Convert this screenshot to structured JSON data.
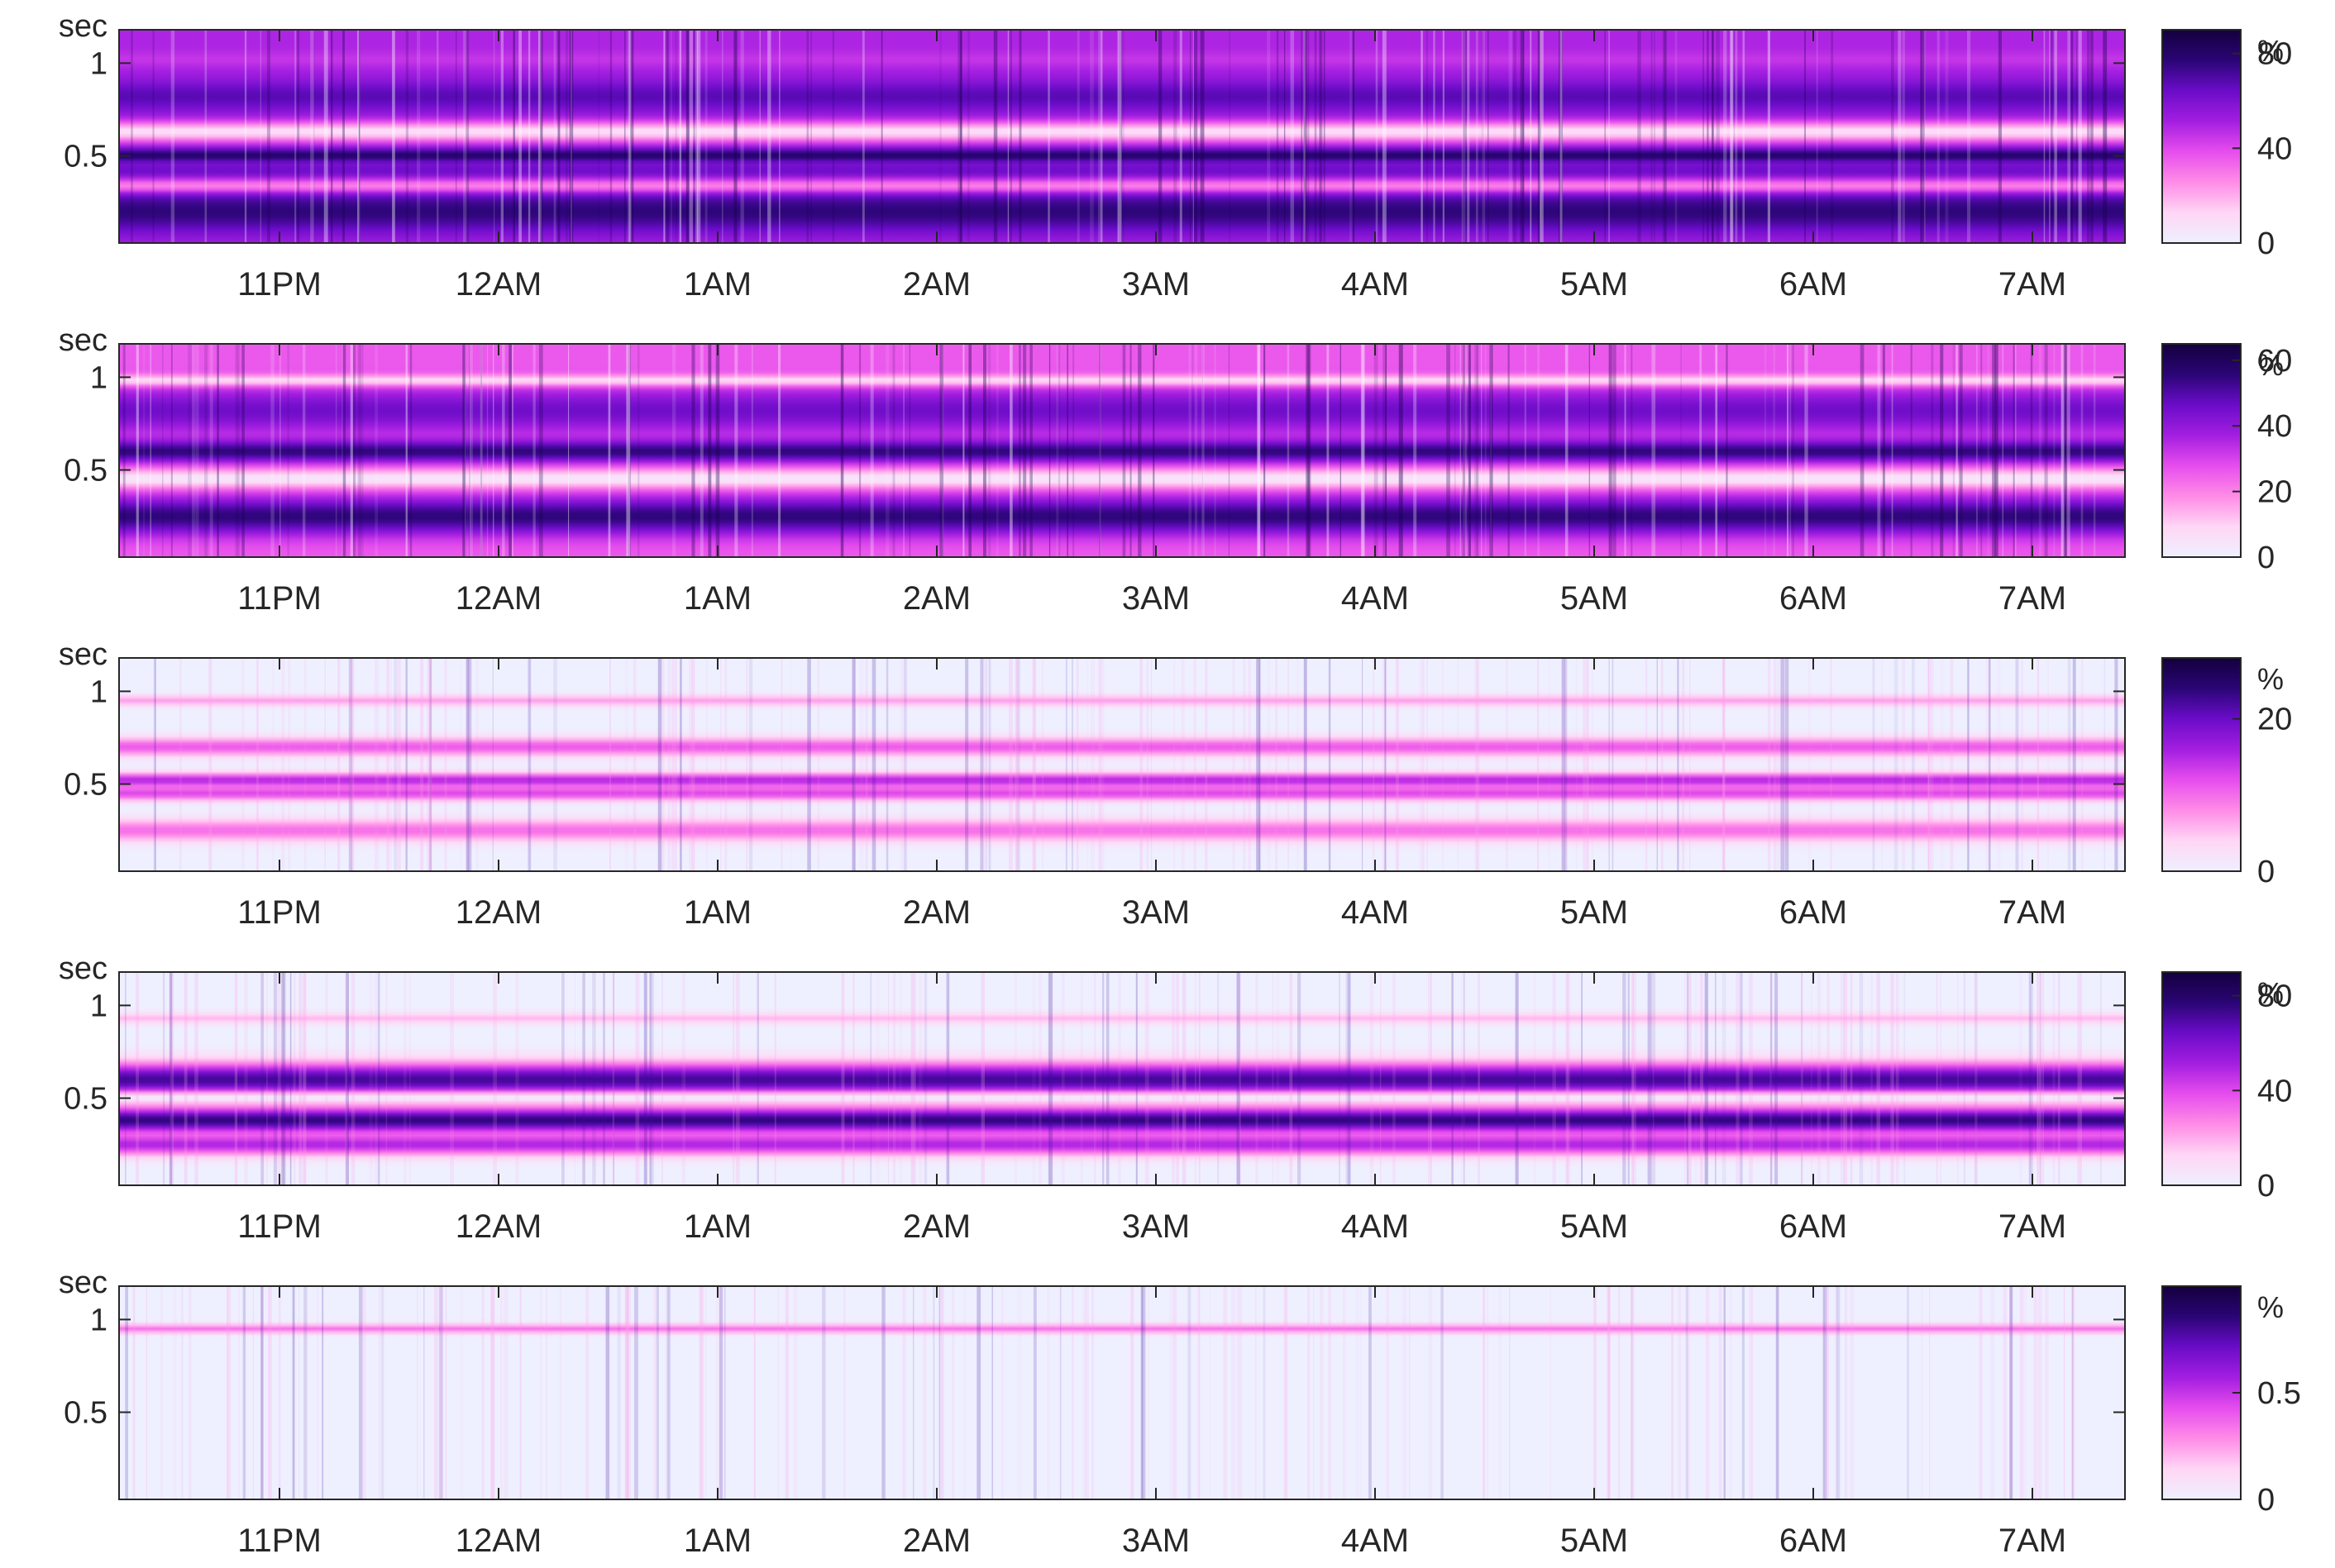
{
  "chart_data": [
    {
      "type": "heatmap",
      "y_unit_label": "sec",
      "y_ticks": [
        "1",
        "0.5"
      ],
      "y_tick_values": [
        1,
        0.5
      ],
      "x_ticks": [
        "11PM",
        "12AM",
        "1AM",
        "2AM",
        "3AM",
        "4AM",
        "5AM",
        "6AM",
        "7AM"
      ],
      "colorbar": {
        "unit": "%",
        "ticks": [
          "0",
          "40",
          "80"
        ],
        "tick_values": [
          0,
          40,
          80
        ],
        "range": [
          0,
          90
        ]
      },
      "bands": [
        {
          "sec": 1.02,
          "level": 0.5,
          "width": 0.04
        },
        {
          "sec": 0.82,
          "level": 0.75,
          "width": 0.09
        },
        {
          "sec": 0.63,
          "level": 0.1,
          "width": 0.05
        },
        {
          "sec": 0.5,
          "level": 0.9,
          "width": 0.04
        },
        {
          "sec": 0.42,
          "level": 0.7,
          "width": 0.05
        },
        {
          "sec": 0.33,
          "level": 0.1,
          "width": 0.04
        },
        {
          "sec": 0.2,
          "level": 0.85,
          "width": 0.12
        }
      ],
      "background_level": 0.55
    },
    {
      "type": "heatmap",
      "y_unit_label": "sec",
      "y_ticks": [
        "1",
        "0.5"
      ],
      "y_tick_values": [
        1,
        0.5
      ],
      "x_ticks": [
        "11PM",
        "12AM",
        "1AM",
        "2AM",
        "3AM",
        "4AM",
        "5AM",
        "6AM",
        "7AM"
      ],
      "colorbar": {
        "unit": "%",
        "ticks": [
          "0",
          "20",
          "40",
          "60"
        ],
        "tick_values": [
          0,
          20,
          40,
          60
        ],
        "range": [
          0,
          65
        ]
      },
      "bands": [
        {
          "sec": 0.98,
          "level": 0.0,
          "width": 0.03
        },
        {
          "sec": 0.82,
          "level": 0.7,
          "width": 0.12
        },
        {
          "sec": 0.6,
          "level": 0.85,
          "width": 0.06
        },
        {
          "sec": 0.45,
          "level": 0.05,
          "width": 0.05
        },
        {
          "sec": 0.25,
          "level": 0.85,
          "width": 0.1
        }
      ],
      "background_level": 0.4
    },
    {
      "type": "heatmap",
      "y_unit_label": "sec",
      "y_ticks": [
        "1",
        "0.5"
      ],
      "y_tick_values": [
        1,
        0.5
      ],
      "x_ticks": [
        "11PM",
        "12AM",
        "1AM",
        "2AM",
        "3AM",
        "4AM",
        "5AM",
        "6AM",
        "7AM"
      ],
      "colorbar": {
        "unit": "%",
        "ticks": [
          "0",
          "20"
        ],
        "tick_values": [
          0,
          20
        ],
        "range": [
          0,
          28
        ]
      },
      "bands": [
        {
          "sec": 0.95,
          "level": 0.25,
          "width": 0.03
        },
        {
          "sec": 0.7,
          "level": 0.4,
          "width": 0.05
        },
        {
          "sec": 0.52,
          "level": 0.55,
          "width": 0.04
        },
        {
          "sec": 0.45,
          "level": 0.45,
          "width": 0.04
        },
        {
          "sec": 0.25,
          "level": 0.35,
          "width": 0.06
        }
      ],
      "background_level": 0.0
    },
    {
      "type": "heatmap",
      "y_unit_label": "sec",
      "y_ticks": [
        "1",
        "0.5"
      ],
      "y_tick_values": [
        1,
        0.5
      ],
      "x_ticks": [
        "11PM",
        "12AM",
        "1AM",
        "2AM",
        "3AM",
        "4AM",
        "5AM",
        "6AM",
        "7AM"
      ],
      "colorbar": {
        "unit": "%",
        "ticks": [
          "0",
          "40",
          "80"
        ],
        "tick_values": [
          0,
          40,
          80
        ],
        "range": [
          0,
          90
        ]
      },
      "bands": [
        {
          "sec": 0.93,
          "level": 0.2,
          "width": 0.03
        },
        {
          "sec": 0.6,
          "level": 0.8,
          "width": 0.09
        },
        {
          "sec": 0.5,
          "level": 0.0,
          "width": 0.03
        },
        {
          "sec": 0.38,
          "level": 0.85,
          "width": 0.07
        },
        {
          "sec": 0.25,
          "level": 0.55,
          "width": 0.06
        }
      ],
      "background_level": 0.0
    },
    {
      "type": "heatmap",
      "y_unit_label": "sec",
      "y_ticks": [
        "1",
        "0.5"
      ],
      "y_tick_values": [
        1,
        0.5
      ],
      "x_ticks": [
        "11PM",
        "12AM",
        "1AM",
        "2AM",
        "3AM",
        "4AM",
        "5AM",
        "6AM",
        "7AM"
      ],
      "colorbar": {
        "unit": "%",
        "ticks": [
          "0",
          "0.5"
        ],
        "tick_values": [
          0,
          0.5
        ],
        "range": [
          0,
          1
        ]
      },
      "bands": [
        {
          "sec": 0.95,
          "level": 0.35,
          "width": 0.025
        }
      ],
      "background_level": 0.0
    }
  ],
  "colormap": [
    "#eef0ff",
    "#ffd6f5",
    "#ff8ce6",
    "#e64ded",
    "#a31ee0",
    "#6a0cc8",
    "#2a0575",
    "#14003d"
  ]
}
